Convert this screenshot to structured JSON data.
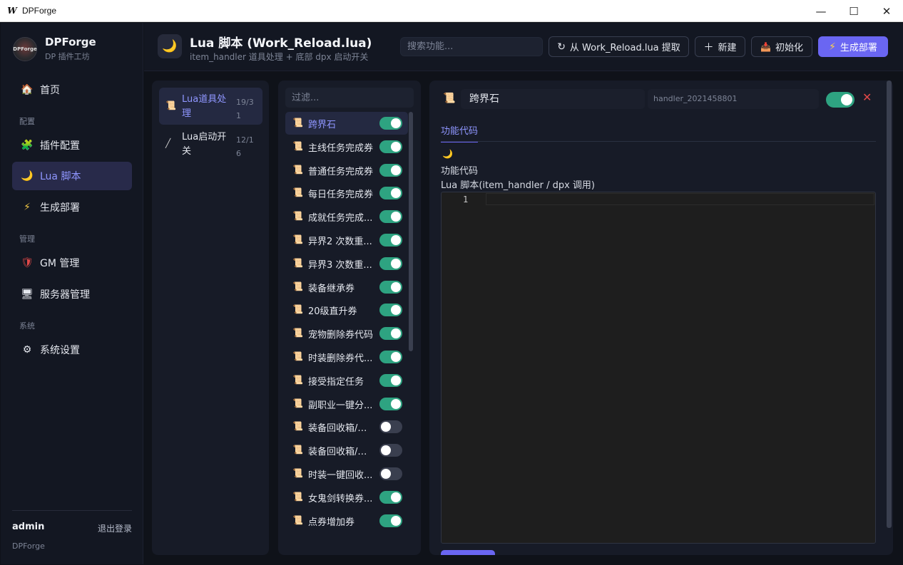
{
  "window": {
    "title": "DPForge",
    "icon_letter": "W",
    "min": "—",
    "max": "☐",
    "close": "✕"
  },
  "brand": {
    "name": "DPForge",
    "subtitle": "DP 插件工坊",
    "logo_text": "DPForge"
  },
  "nav": {
    "home": "首页",
    "section_config": "配置",
    "plugin_config": "插件配置",
    "lua_script": "Lua 脚本",
    "generate_deploy": "生成部署",
    "section_manage": "管理",
    "gm_manage": "GM 管理",
    "server_manage": "服务器管理",
    "section_system": "系统",
    "system_settings": "系统设置"
  },
  "user": {
    "name": "admin",
    "logout": "退出登录",
    "footer": "DPForge"
  },
  "header": {
    "title": "Lua 脚本 (Work_Reload.lua)",
    "subtitle": "item_handler 道具处理 + 底部 dpx 启动开关",
    "search_placeholder": "搜索功能...",
    "btn_extract": "从 Work_Reload.lua 提取",
    "btn_new": "新建",
    "btn_init": "初始化",
    "btn_deploy": "生成部署"
  },
  "categories": [
    {
      "label": "Lua道具处理",
      "count": "19/31",
      "active": true
    },
    {
      "label": "Lua启动开关",
      "count": "12/16",
      "active": false
    }
  ],
  "filter_placeholder": "过滤...",
  "scripts": [
    {
      "label": "跨界石",
      "on": true,
      "active": true
    },
    {
      "label": "主线任务完成券",
      "on": true
    },
    {
      "label": "普通任务完成券",
      "on": true
    },
    {
      "label": "每日任务完成券",
      "on": true
    },
    {
      "label": "成就任务完成...",
      "on": true
    },
    {
      "label": "异界2 次数重...",
      "on": true
    },
    {
      "label": "异界3 次数重...",
      "on": true
    },
    {
      "label": "装备继承券",
      "on": true
    },
    {
      "label": "20级直升券",
      "on": true
    },
    {
      "label": "宠物删除券代码",
      "on": true
    },
    {
      "label": "时装删除券代...",
      "on": true
    },
    {
      "label": "接受指定任务",
      "on": true
    },
    {
      "label": "副职业一键分...",
      "on": true
    },
    {
      "label": "装备回收箱/多...",
      "on": false
    },
    {
      "label": "装备回收箱/多...",
      "on": false
    },
    {
      "label": "时装一键回收...",
      "on": false
    },
    {
      "label": "女鬼剑转换券...",
      "on": true
    },
    {
      "label": "点券增加券",
      "on": true
    }
  ],
  "editor": {
    "name": "跨界石",
    "handler": "handler_2021458801",
    "enabled": true,
    "tab": "功能代码",
    "emoji": "🌙",
    "section_title": "功能代码",
    "code_label": "Lua 脚本(item_handler / dpx 调用)",
    "line_number": "1"
  },
  "colors": {
    "accent": "#6a66f2",
    "toggle_on": "#2ea381",
    "danger": "#e04848"
  }
}
